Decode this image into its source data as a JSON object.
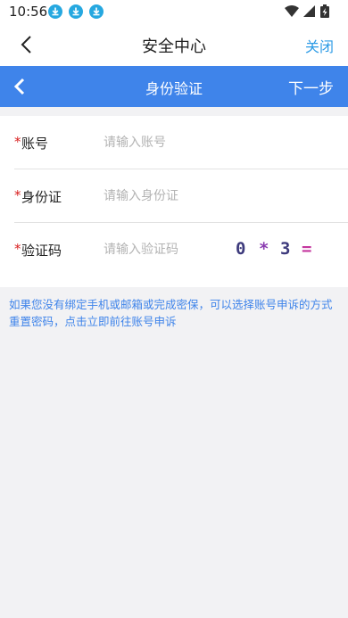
{
  "status_bar": {
    "time": "10:56",
    "notification_icons": [
      "download-icon",
      "download-icon",
      "download-icon"
    ],
    "right_icons": [
      "wifi-icon",
      "signal-icon",
      "battery-charging-icon"
    ]
  },
  "header": {
    "back_icon": "chevron-left-icon",
    "title": "安全中心",
    "close_label": "关闭"
  },
  "step_bar": {
    "back_icon": "chevron-left-icon",
    "title": "身份验证",
    "next_label": "下一步",
    "background_color": "#3f84ea"
  },
  "form": {
    "fields": [
      {
        "required_mark": "*",
        "label": "账号",
        "placeholder": "请输入账号",
        "value": ""
      },
      {
        "required_mark": "*",
        "label": "身份证",
        "placeholder": "请输入身份证",
        "value": ""
      },
      {
        "required_mark": "*",
        "label": "验证码",
        "placeholder": "请输入验证码",
        "value": ""
      }
    ],
    "captcha": {
      "chars": [
        "0",
        "*",
        "3",
        "="
      ],
      "colors": [
        "#3d3a7c",
        "#8a3bb0",
        "#3d3a7c",
        "#c4369e"
      ]
    }
  },
  "help_text": "如果您没有绑定手机或邮箱或完成密保，可以选择账号申诉的方式重置密码，点击立即前往账号申诉",
  "colors": {
    "accent": "#3f84ea",
    "close_link": "#2c9be6",
    "required_mark": "#d81e1e"
  }
}
